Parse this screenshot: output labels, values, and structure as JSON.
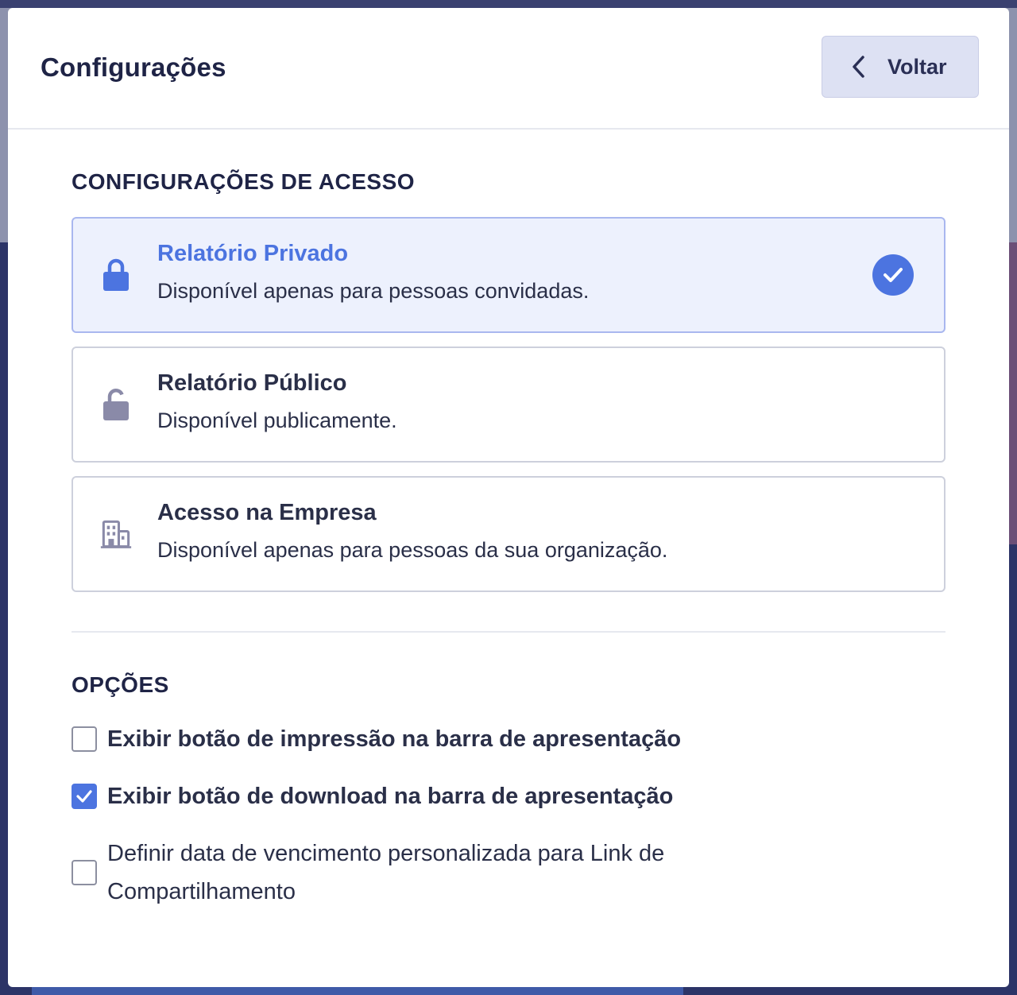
{
  "modal": {
    "title": "Configurações",
    "back_label": "Voltar"
  },
  "access": {
    "heading": "CONFIGURAÇÕES DE ACESSO",
    "options": [
      {
        "title": "Relatório Privado",
        "description": "Disponível apenas para pessoas convidadas.",
        "icon": "lock-icon",
        "selected": true
      },
      {
        "title": "Relatório Público",
        "description": "Disponível publicamente.",
        "icon": "unlock-icon",
        "selected": false
      },
      {
        "title": "Acesso na Empresa",
        "description": "Disponível apenas para pessoas da sua organização.",
        "icon": "building-icon",
        "selected": false
      }
    ]
  },
  "options": {
    "heading": "OPÇÕES",
    "print": {
      "prefix": "Exibir botão de ",
      "emphasis": "impressão",
      "suffix": " na barra de apresentação",
      "checked": false
    },
    "download": {
      "prefix": "Exibir botão de ",
      "emphasis": "download",
      "suffix": " na barra de apresentação",
      "checked": true
    },
    "expiry": {
      "label": "Definir data de vencimento personalizada para Link de Compartilhamento",
      "checked": false
    }
  },
  "colors": {
    "accent": "#4c74e0",
    "selected_bg": "#edf1fd",
    "text": "#2a2f48",
    "heading": "#1f2446"
  }
}
